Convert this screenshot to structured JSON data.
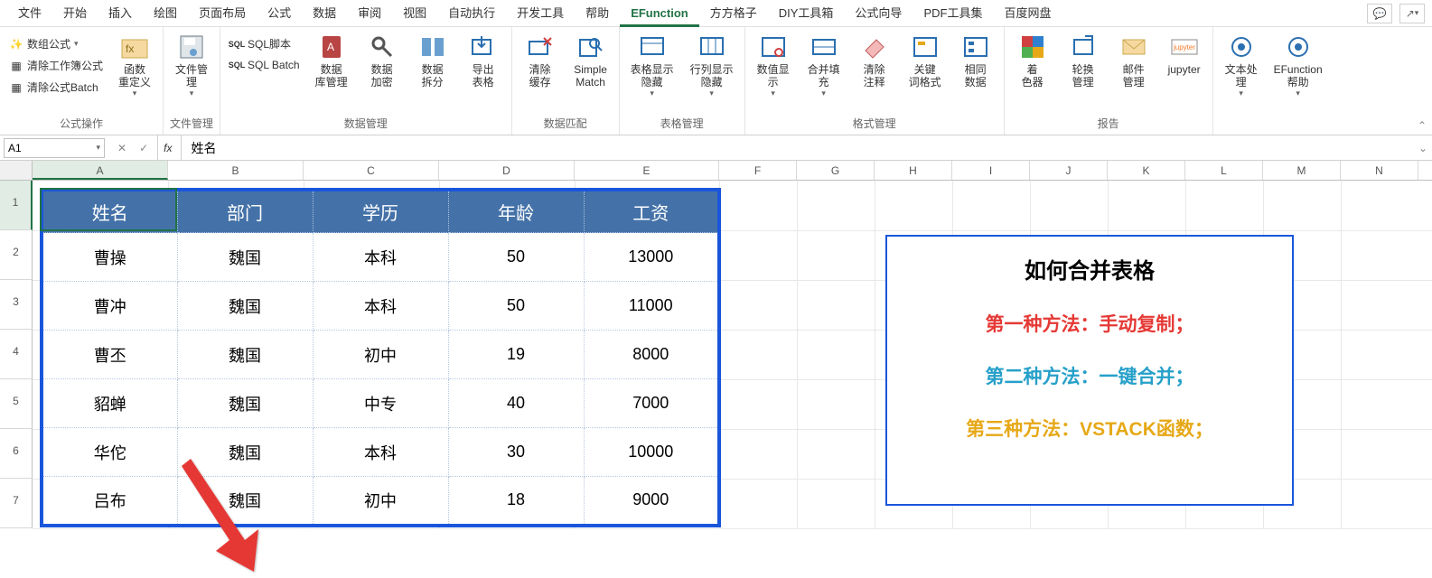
{
  "menu": {
    "items": [
      "文件",
      "开始",
      "插入",
      "绘图",
      "页面布局",
      "公式",
      "数据",
      "审阅",
      "视图",
      "自动执行",
      "开发工具",
      "帮助",
      "EFunction",
      "方方格子",
      "DIY工具箱",
      "公式向导",
      "PDF工具集",
      "百度网盘"
    ],
    "active_index": 12
  },
  "ribbon": {
    "groups": [
      {
        "label": "公式操作",
        "small": [
          "数组公式",
          "清除工作簿公式",
          "清除公式Batch"
        ],
        "big": [
          {
            "label": "函数\n重定义",
            "icon": "fx"
          }
        ]
      },
      {
        "label": "文件管理",
        "big": [
          {
            "label": "文件管\n理",
            "icon": "disk"
          }
        ]
      },
      {
        "label": "数据管理",
        "small": [
          "SQL脚本",
          "SQL Batch"
        ],
        "big": [
          {
            "label": "数据\n库管理",
            "icon": "db"
          },
          {
            "label": "数据\n加密",
            "icon": "key"
          },
          {
            "label": "数据\n拆分",
            "icon": "split"
          },
          {
            "label": "导出\n表格",
            "icon": "export"
          }
        ]
      },
      {
        "label": "数据匹配",
        "big": [
          {
            "label": "清除\n缓存",
            "icon": "cache"
          },
          {
            "label": "Simple\nMatch",
            "icon": "match"
          }
        ]
      },
      {
        "label": "表格管理",
        "big": [
          {
            "label": "表格显示\n隐藏",
            "icon": "sheetshow"
          },
          {
            "label": "行列显示\n隐藏",
            "icon": "rowcol"
          }
        ]
      },
      {
        "label": "格式管理",
        "big": [
          {
            "label": "数值显\n示",
            "icon": "numfmt"
          },
          {
            "label": "合并填\n充",
            "icon": "merge"
          },
          {
            "label": "清除\n注释",
            "icon": "clearcm"
          },
          {
            "label": "关键\n词格式",
            "icon": "keyfmt"
          },
          {
            "label": "相同\n数据",
            "icon": "same"
          }
        ]
      },
      {
        "label": "报告",
        "big": [
          {
            "label": "着\n色器",
            "icon": "color"
          },
          {
            "label": "轮换\n管理",
            "icon": "rotate"
          },
          {
            "label": "邮件\n管理",
            "icon": "mail"
          },
          {
            "label": "jupyter",
            "icon": "jupyter"
          }
        ]
      },
      {
        "label": "",
        "big": [
          {
            "label": "文本处\n理",
            "icon": "text"
          },
          {
            "label": "EFunction\n帮助",
            "icon": "help"
          }
        ]
      }
    ]
  },
  "namebox": {
    "value": "A1"
  },
  "formula": {
    "fx": "fx",
    "value": "姓名"
  },
  "columns": [
    "A",
    "B",
    "C",
    "D",
    "E",
    "F",
    "G",
    "H",
    "I",
    "J",
    "K",
    "L",
    "M",
    "N"
  ],
  "row_numbers": [
    1,
    2,
    3,
    4,
    5,
    6,
    7
  ],
  "table": {
    "headers": [
      "姓名",
      "部门",
      "学历",
      "年龄",
      "工资"
    ],
    "rows": [
      [
        "曹操",
        "魏国",
        "本科",
        "50",
        "13000"
      ],
      [
        "曹冲",
        "魏国",
        "本科",
        "50",
        "11000"
      ],
      [
        "曹丕",
        "魏国",
        "初中",
        "19",
        "8000"
      ],
      [
        "貂蝉",
        "魏国",
        "中专",
        "40",
        "7000"
      ],
      [
        "华佗",
        "魏国",
        "本科",
        "30",
        "10000"
      ],
      [
        "吕布",
        "魏国",
        "初中",
        "18",
        "9000"
      ]
    ]
  },
  "note": {
    "title": "如何合并表格",
    "line1": "第一种方法：手动复制；",
    "line2": "第二种方法：一键合并；",
    "line3": "第三种方法：VSTACK函数；"
  }
}
